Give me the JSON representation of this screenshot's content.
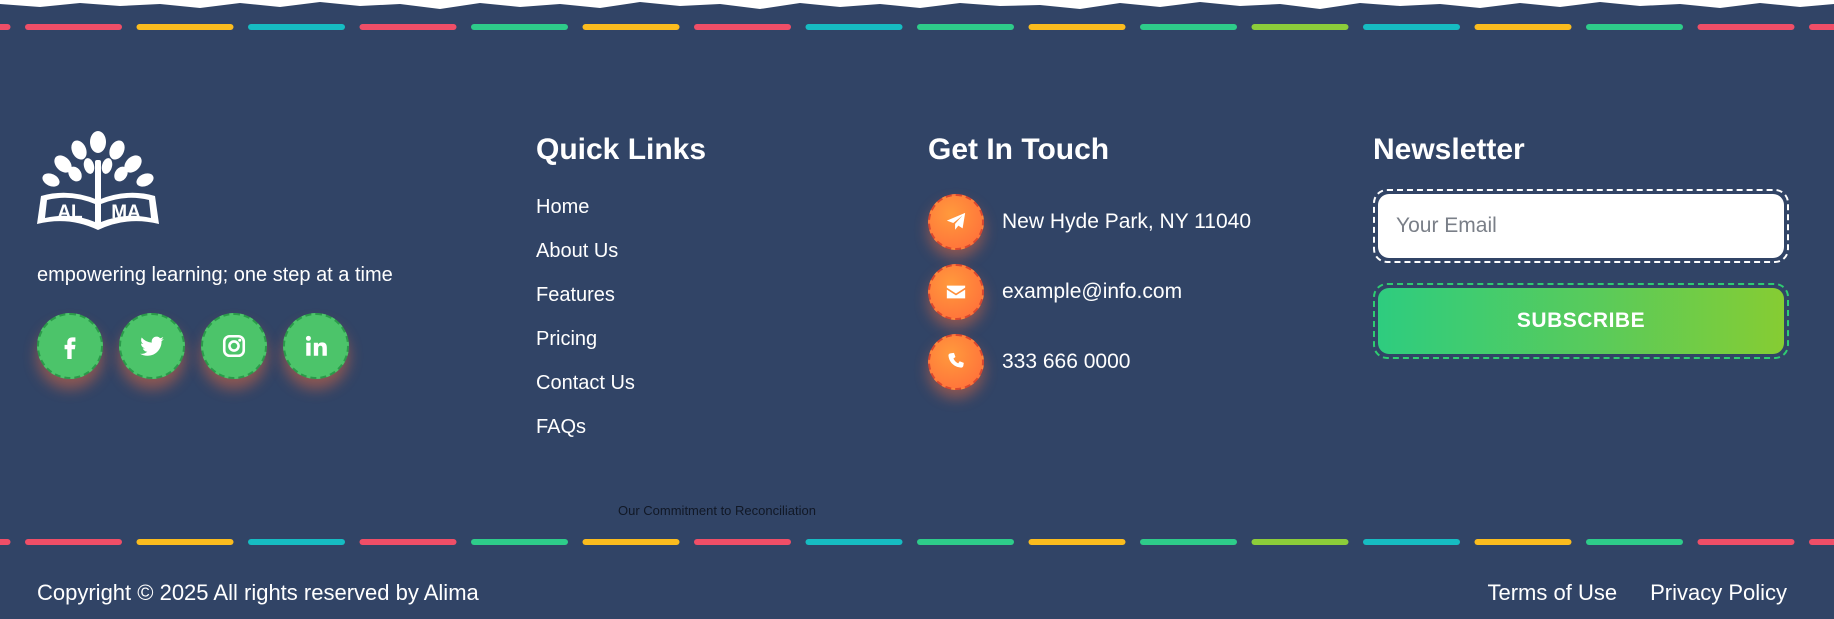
{
  "brand": {
    "logo_text": "AL MA",
    "tagline": "empowering learning; one step at a time",
    "socials": [
      {
        "icon": "facebook-icon"
      },
      {
        "icon": "twitter-icon"
      },
      {
        "icon": "instagram-icon"
      },
      {
        "icon": "linkedin-icon"
      }
    ]
  },
  "quick_links": {
    "title": "Quick Links",
    "items": [
      "Home",
      "About Us",
      "Features",
      "Pricing",
      "Contact Us",
      "FAQs"
    ]
  },
  "contact": {
    "title": "Get In Touch",
    "items": [
      {
        "icon": "paper-plane-icon",
        "text": "New Hyde Park, NY 11040"
      },
      {
        "icon": "envelope-icon",
        "text": "example@info.com"
      },
      {
        "icon": "phone-icon",
        "text": "333 666 0000"
      }
    ]
  },
  "newsletter": {
    "title": "Newsletter",
    "email_placeholder": "Your Email",
    "email_value": "",
    "subscribe_label": "SUBSCRIBE"
  },
  "reconciliation_link": "Our Commitment to Reconciliation",
  "bottom": {
    "copyright": "Copyright © 2025 All rights reserved by Alima",
    "terms": "Terms of Use",
    "privacy": "Privacy Policy"
  },
  "colors": {
    "background": "#314466",
    "social_green": "#4cc46a",
    "contact_orange": "#ff7a3a",
    "dash_palette": [
      "#ef4e67",
      "#fbbc1e",
      "#16bcc2",
      "#2ecc8a",
      "#8ccd3a"
    ]
  }
}
